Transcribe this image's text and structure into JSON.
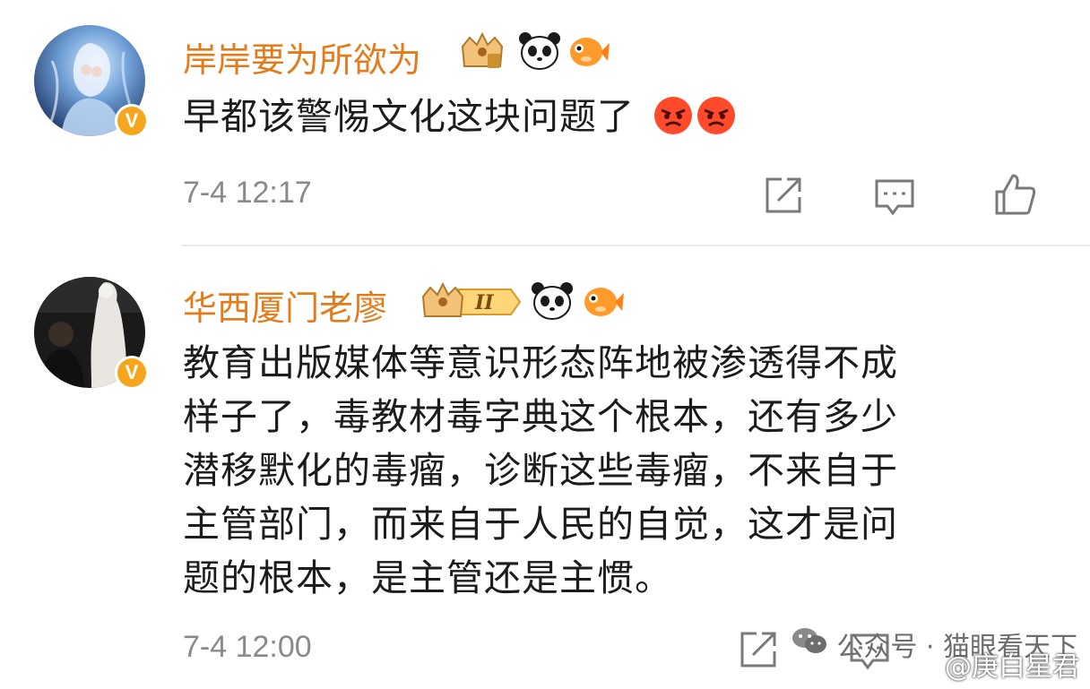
{
  "comments": [
    {
      "username": "岸岸要为所欲为",
      "text": "早都该警惕文化这块问题了",
      "emojis": [
        "angry-face-icon",
        "angry-face-icon"
      ],
      "time": "7-4 12:17",
      "verified": "V",
      "avatar": "anime-character-avatar",
      "badges": [
        "crown-fan-badge-icon",
        "panda-icon",
        "goldfish-icon"
      ]
    },
    {
      "username": "华西厦门老廖",
      "text_lines": [
        "教育出版媒体等意识形态阵地被渗透得不成",
        "样子了，毒教材毒字典这个根本，还有多少",
        "潜移默化的毒瘤，诊断这些毒瘤，不来自于",
        "主管部门，而来自于人民的自觉，这才是问",
        "题的根本，是主管还是主惯。"
      ],
      "time": "7-4 12:00",
      "verified": "V",
      "avatar": "statue-photo-avatar",
      "vip_level": "II",
      "badges": [
        "crown-vip-badge-icon",
        "panda-icon",
        "goldfish-icon"
      ]
    }
  ],
  "actions": [
    "repost-icon",
    "comment-icon",
    "like-icon"
  ],
  "watermark": {
    "wechat": "公众号 · 猫眼看天下",
    "weibo": "@庚白星君"
  },
  "colors": {
    "username": "#e47b1b",
    "verified_badge": "#f7a51c",
    "time": "#8a8a8a",
    "divider": "#ececec"
  }
}
